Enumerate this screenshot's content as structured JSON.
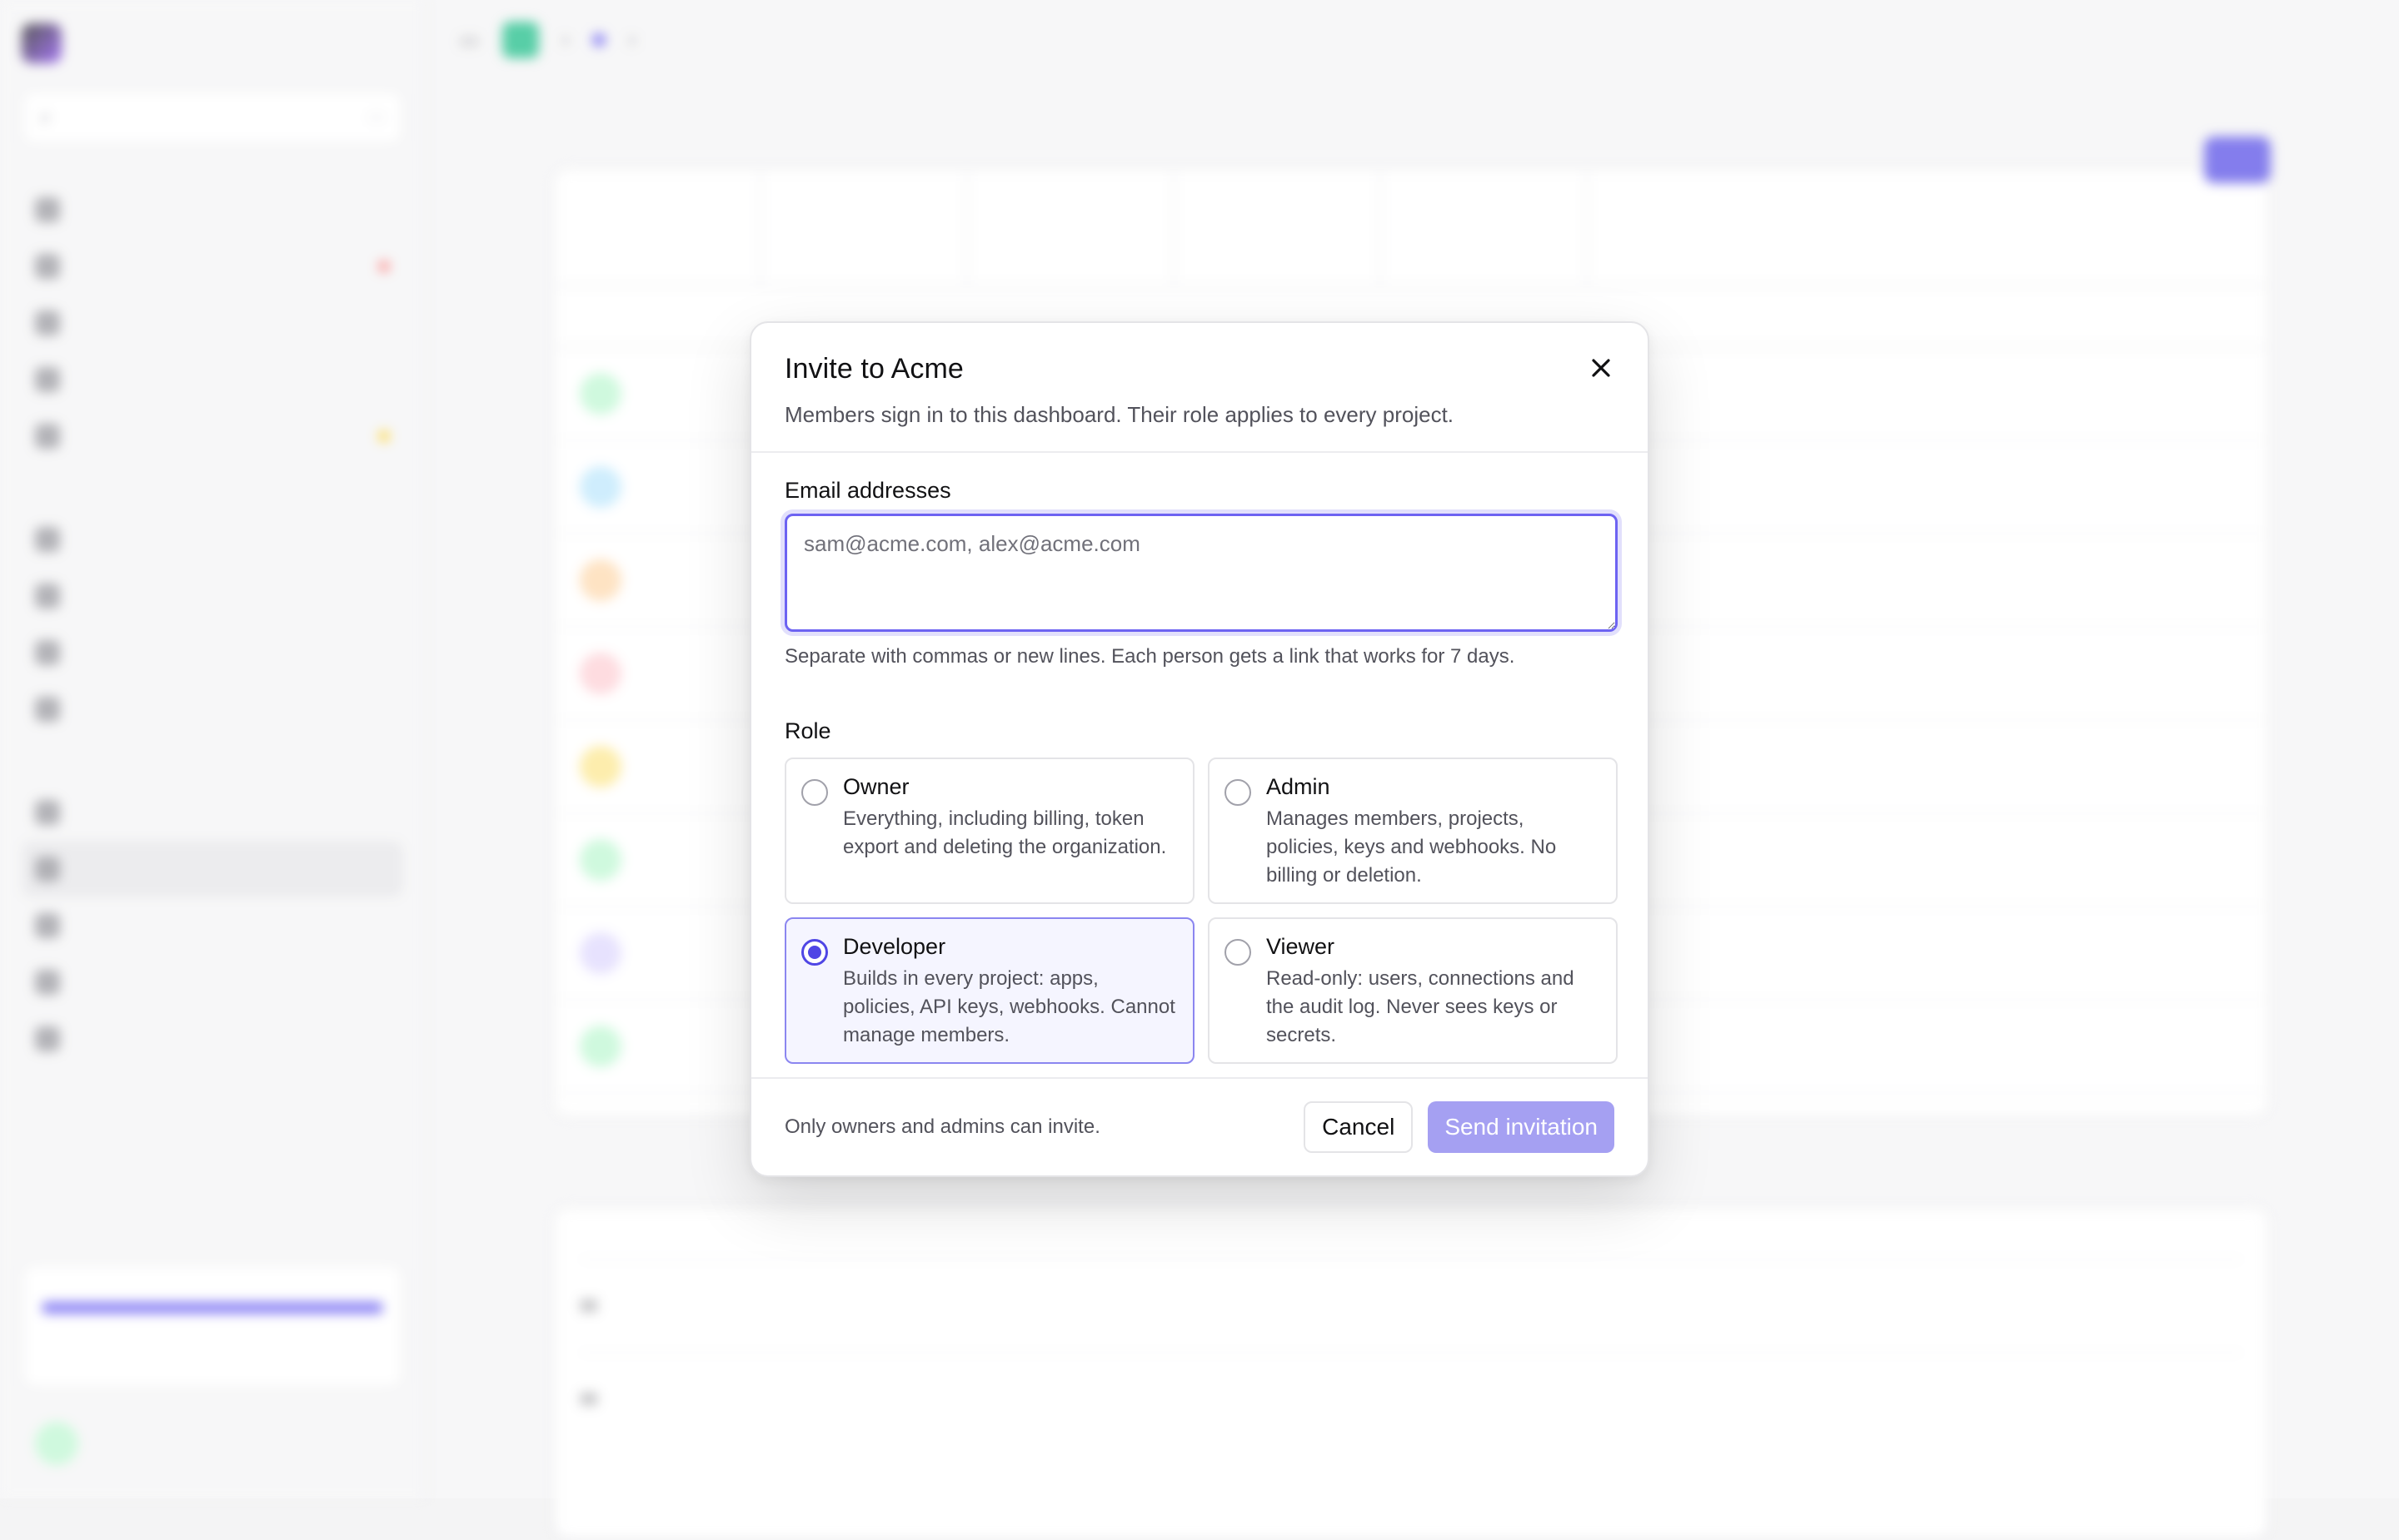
{
  "modal": {
    "title": "Invite to Acme",
    "subtitle": "Members sign in to this dashboard. Their role applies to every project.",
    "close_icon": "close-icon",
    "email": {
      "label": "Email addresses",
      "value": "",
      "placeholder": "sam@acme.com, alex@acme.com",
      "help": "Separate with commas or new lines. Each person gets a link that works for 7 days."
    },
    "role": {
      "label": "Role",
      "selected": "Developer",
      "options": [
        {
          "name": "Owner",
          "description": "Everything, including billing, token export and deleting the organization."
        },
        {
          "name": "Admin",
          "description": "Manages members, projects, policies, keys and webhooks. No billing or deletion."
        },
        {
          "name": "Developer",
          "description": "Builds in every project: apps, policies, API keys, webhooks. Cannot manage members."
        },
        {
          "name": "Viewer",
          "description": "Read-only: users, connections and the audit log. Never sees keys or secrets."
        }
      ]
    },
    "footer": {
      "note": "Only owners and admins can invite.",
      "cancel_label": "Cancel",
      "send_label": "Send invitation"
    }
  },
  "colors": {
    "accent": "#4f46e5",
    "accent_disabled": "#a5a0f2",
    "focus_ring": "#6d63f2",
    "selected_bg": "#f5f5ff"
  }
}
